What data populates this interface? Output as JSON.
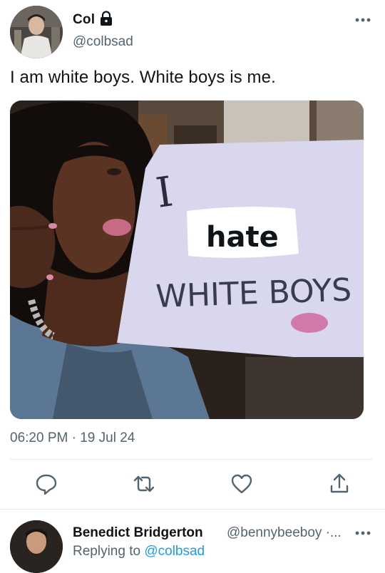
{
  "tweet": {
    "display_name": "Col",
    "handle": "@colbsad",
    "text": "I am white boys. White boys is me.",
    "timestamp": "06:20 PM · 19 Jul 24",
    "media": {
      "sign_line1": "I",
      "sign_sticker": "hate",
      "sign_line3": "WHITE BOYS"
    }
  },
  "actions": {
    "reply_icon": "reply-icon",
    "retweet_icon": "retweet-icon",
    "like_icon": "heart-icon",
    "share_icon": "share-icon"
  },
  "reply": {
    "display_name": "Benedict Bridgerton",
    "handle": "@bennybeeboy ·...",
    "replying_prefix": "Replying to",
    "replying_to": "@colbsad"
  },
  "colors": {
    "text_primary": "#0f1419",
    "text_secondary": "#536471",
    "link": "#1d9bf0",
    "divider": "#e6e9eb"
  }
}
